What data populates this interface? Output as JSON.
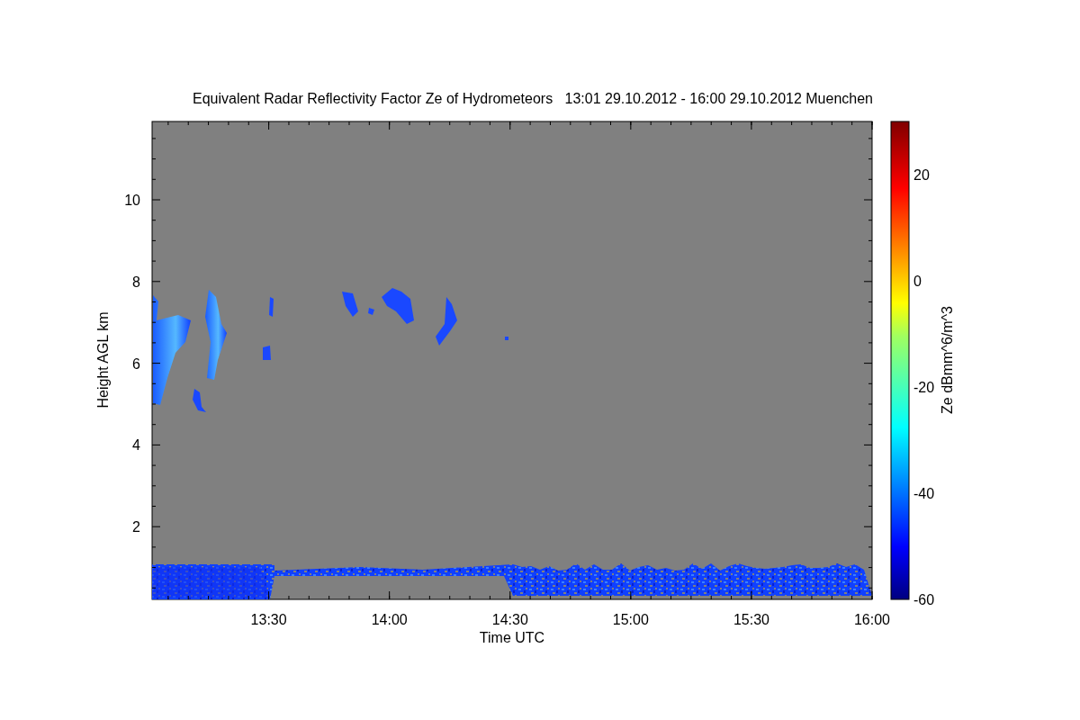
{
  "title": "Equivalent Radar Reflectivity Factor Ze of Hydrometeors   13:01 29.10.2012 - 16:00 29.10.2012 Muenchen",
  "plot": {
    "ylabel": "Height AGL km",
    "xlabel": "Time UTC",
    "yticks": [
      "10",
      "8",
      "6",
      "4",
      "2"
    ],
    "xticks": [
      "13:30",
      "14:00",
      "14:30",
      "15:00",
      "15:30",
      "16:00"
    ]
  },
  "colorbar": {
    "label": "Ze dBmm^6/m^3",
    "ticks": [
      "20",
      "0",
      "-20",
      "-40",
      "-60"
    ]
  }
}
